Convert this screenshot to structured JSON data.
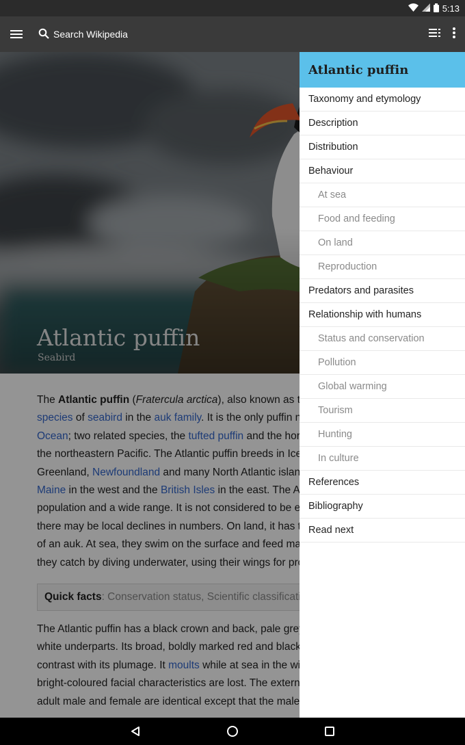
{
  "status_bar": {
    "time": "5:13"
  },
  "toolbar": {
    "search_placeholder": "Search Wikipedia"
  },
  "hero": {
    "title": "Atlantic puffin",
    "subtitle": "Seabird"
  },
  "article": {
    "p1": [
      {
        "t": "The "
      },
      {
        "t": "Atlantic puffin",
        "b": true
      },
      {
        "t": " ("
      },
      {
        "t": "Fratercula arctica",
        "i": true
      },
      {
        "t": "), also known as the common puffin, is a "
      },
      {
        "t": "species",
        "link": true
      },
      {
        "t": " of "
      },
      {
        "t": "seabird",
        "link": true
      },
      {
        "t": " in the "
      },
      {
        "t": "auk family",
        "link": true
      },
      {
        "t": ". It is the only puffin native to the "
      },
      {
        "t": "Atlantic Ocean",
        "link": true
      },
      {
        "t": "; two related species, the "
      },
      {
        "t": "tufted puffin",
        "link": true
      },
      {
        "t": " and the horned puffin, are found in the northeastern Pacific. The Atlantic puffin breeds in Iceland, Norway, Greenland, "
      },
      {
        "t": "Newfoundland",
        "link": true
      },
      {
        "t": " and many North Atlantic islands, and as far south as "
      },
      {
        "t": "Maine",
        "link": true
      },
      {
        "t": " in the west and the "
      },
      {
        "t": "British Isles",
        "link": true
      },
      {
        "t": " in the east. The Atlantic puffin has a large population and a wide range. It is not considered to be endangered although there may be local declines in numbers. On land, it has the typical upright stance of an auk. At sea, they swim on the surface and feed mainly on small fish, which they catch by diving underwater, using their wings for propulsion."
      }
    ],
    "quick_facts_label": "Quick facts",
    "quick_facts_rest": ": Conservation status, Scientific classification",
    "p2": [
      {
        "t": "The Atlantic puffin has a black crown and back, pale grey cheek patches and white underparts. Its broad, boldly marked red and black beak and orange legs contrast with its plumage. It "
      },
      {
        "t": "moults",
        "link": true
      },
      {
        "t": " while at sea in the winter and some of the bright-coloured facial characteristics are lost. The external appearance of the adult male and female are identical except that the male is usually slightly larger."
      }
    ]
  },
  "toc": {
    "title": "Atlantic puffin",
    "items": [
      {
        "label": "Taxonomy and etymology",
        "level": 1
      },
      {
        "label": "Description",
        "level": 1
      },
      {
        "label": "Distribution",
        "level": 1
      },
      {
        "label": "Behaviour",
        "level": 1
      },
      {
        "label": "At sea",
        "level": 2
      },
      {
        "label": "Food and feeding",
        "level": 2
      },
      {
        "label": "On land",
        "level": 2
      },
      {
        "label": "Reproduction",
        "level": 2
      },
      {
        "label": "Predators and parasites",
        "level": 1
      },
      {
        "label": "Relationship with humans",
        "level": 1
      },
      {
        "label": "Status and conservation",
        "level": 2
      },
      {
        "label": "Pollution",
        "level": 2
      },
      {
        "label": "Global warming",
        "level": 2
      },
      {
        "label": "Tourism",
        "level": 2
      },
      {
        "label": "Hunting",
        "level": 2
      },
      {
        "label": "In culture",
        "level": 2
      },
      {
        "label": "References",
        "level": 1
      },
      {
        "label": "Bibliography",
        "level": 1
      },
      {
        "label": "Read next",
        "level": 1
      }
    ]
  },
  "icons": {
    "menu": "hamburger-icon",
    "search": "search-icon",
    "toc": "table-of-contents-icon",
    "overflow": "more-vert-icon",
    "wifi": "wifi-icon",
    "signal": "signal-icon",
    "battery": "battery-icon",
    "back": "back-icon",
    "home": "home-icon",
    "recents": "recents-icon"
  },
  "colors": {
    "toolbar": "#3a3a3a",
    "toc_header": "#5bc0ea",
    "link": "#3366cc",
    "status_bar": "#2b2b2b"
  }
}
